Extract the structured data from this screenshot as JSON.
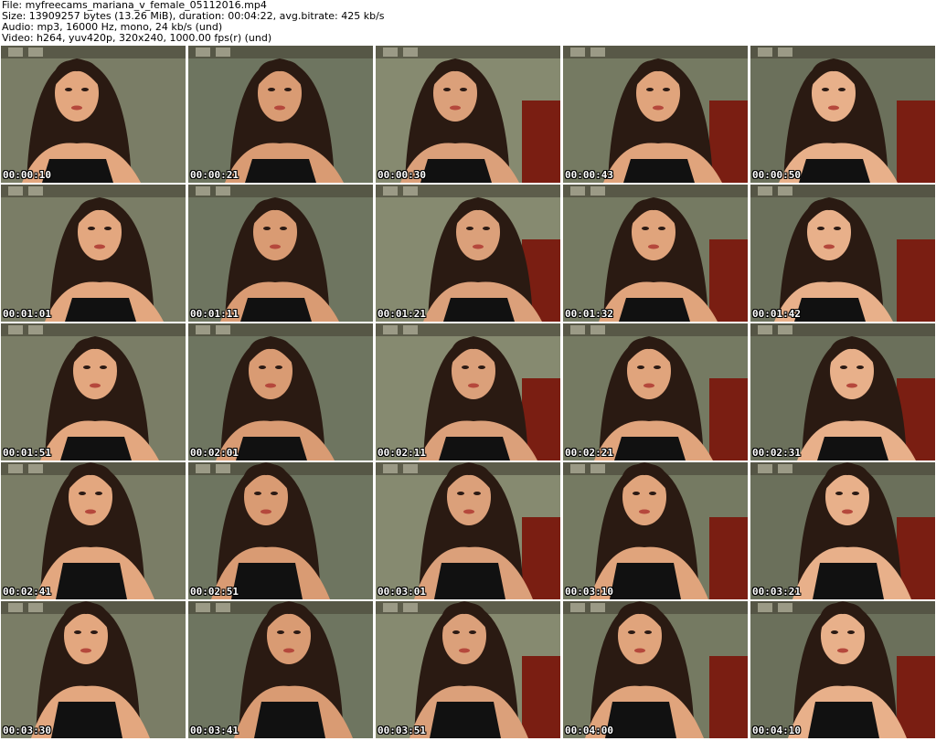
{
  "header": {
    "file": "File: myfreecams_mariana_v_female_05112016.mp4",
    "size": "Size: 13909257 bytes (13.26 MiB), duration: 00:04:22, avg.bitrate: 425 kb/s",
    "audio": "Audio: mp3, 16000 Hz, mono, 24 kb/s (und)",
    "video": "Video: h264, yuv420p, 320x240, 1000.00 fps(r) (und)"
  },
  "thumbnails": [
    {
      "time": "00:00:10"
    },
    {
      "time": "00:00:21"
    },
    {
      "time": "00:00:30"
    },
    {
      "time": "00:00:43"
    },
    {
      "time": "00:00:50"
    },
    {
      "time": "00:01:01"
    },
    {
      "time": "00:01:11"
    },
    {
      "time": "00:01:21"
    },
    {
      "time": "00:01:32"
    },
    {
      "time": "00:01:42"
    },
    {
      "time": "00:01:51"
    },
    {
      "time": "00:02:01"
    },
    {
      "time": "00:02:11"
    },
    {
      "time": "00:02:21"
    },
    {
      "time": "00:02:31"
    },
    {
      "time": "00:02:41"
    },
    {
      "time": "00:02:51"
    },
    {
      "time": "00:03:01"
    },
    {
      "time": "00:03:10"
    },
    {
      "time": "00:03:21"
    },
    {
      "time": "00:03:30"
    },
    {
      "time": "00:03:41"
    },
    {
      "time": "00:03:51"
    },
    {
      "time": "00:04:00"
    },
    {
      "time": "00:04:10"
    }
  ]
}
